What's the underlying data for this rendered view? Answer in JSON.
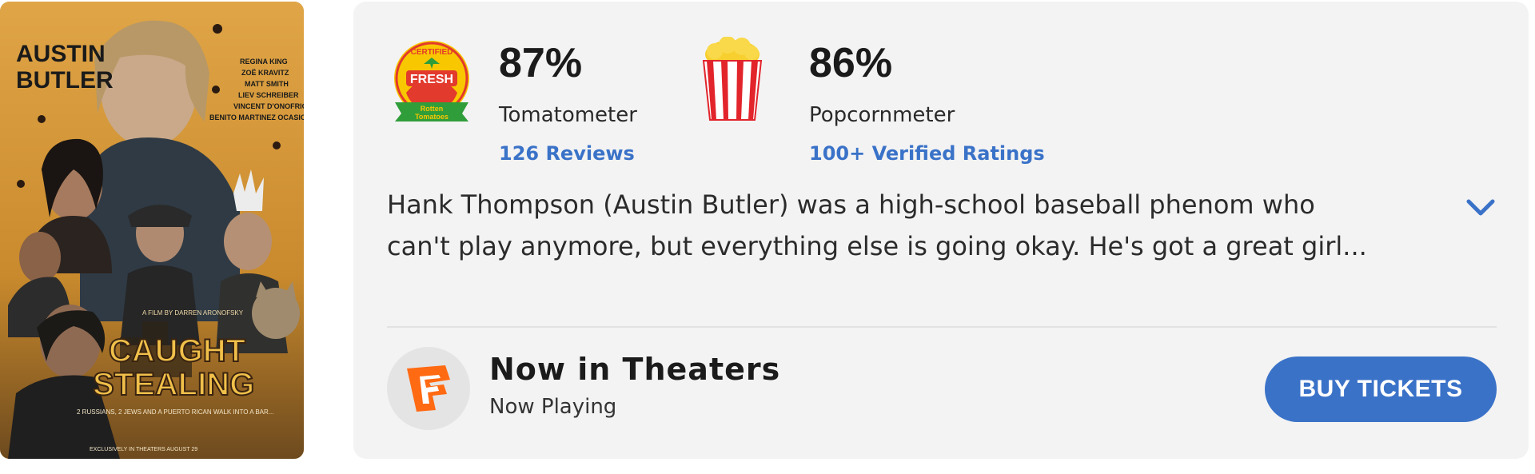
{
  "poster": {
    "actor_name": "AUSTIN BUTLER",
    "cast_list": [
      "REGINA KING",
      "ZOË KRAVITZ",
      "MATT SMITH",
      "LIEV SCHREIBER",
      "VINCENT D'ONOFRIO",
      "BENITO MARTINEZ OCASIO"
    ],
    "title_line1": "CAUGHT",
    "title_line2": "STEALING",
    "tagline": "2 RUSSIANS, 2 JEWS AND A PUERTO RICAN WALK INTO A BAR...",
    "credit": "A FILM BY DARREN ARONOFSKY",
    "release": "EXCLUSIVELY IN THEATERS AUGUST 29",
    "bg_color": "#d89b3a"
  },
  "scores": {
    "tomatometer": {
      "percent": "87%",
      "label": "Tomatometer",
      "reviews_link": "126 Reviews",
      "badge_top": "CERTIFIED",
      "badge_middle": "FRESH",
      "badge_bottom": "Rotten Tomatoes",
      "icon": "certified-fresh-icon"
    },
    "popcornmeter": {
      "percent": "86%",
      "label": "Popcornmeter",
      "ratings_link": "100+ Verified Ratings",
      "icon": "popcorn-bucket-icon"
    }
  },
  "synopsis": {
    "line1": "Hank Thompson (Austin Butler) was a high-school baseball phenom who",
    "line2": "can't play anymore, but everything else is going okay. He's got a great girl...",
    "expand_icon": "chevron-down-icon"
  },
  "theaters": {
    "title": "Now in Theaters",
    "subtitle": "Now Playing",
    "logo_letter": "F",
    "logo_icon": "fandango-logo-icon",
    "buy_label": "BUY TICKETS"
  },
  "colors": {
    "accent_blue": "#3a72c8",
    "card_bg": "#f3f3f3",
    "fandango_orange": "#ff6a13",
    "tomato_red": "#e23a2c",
    "popcorn_red": "#e2242b"
  }
}
